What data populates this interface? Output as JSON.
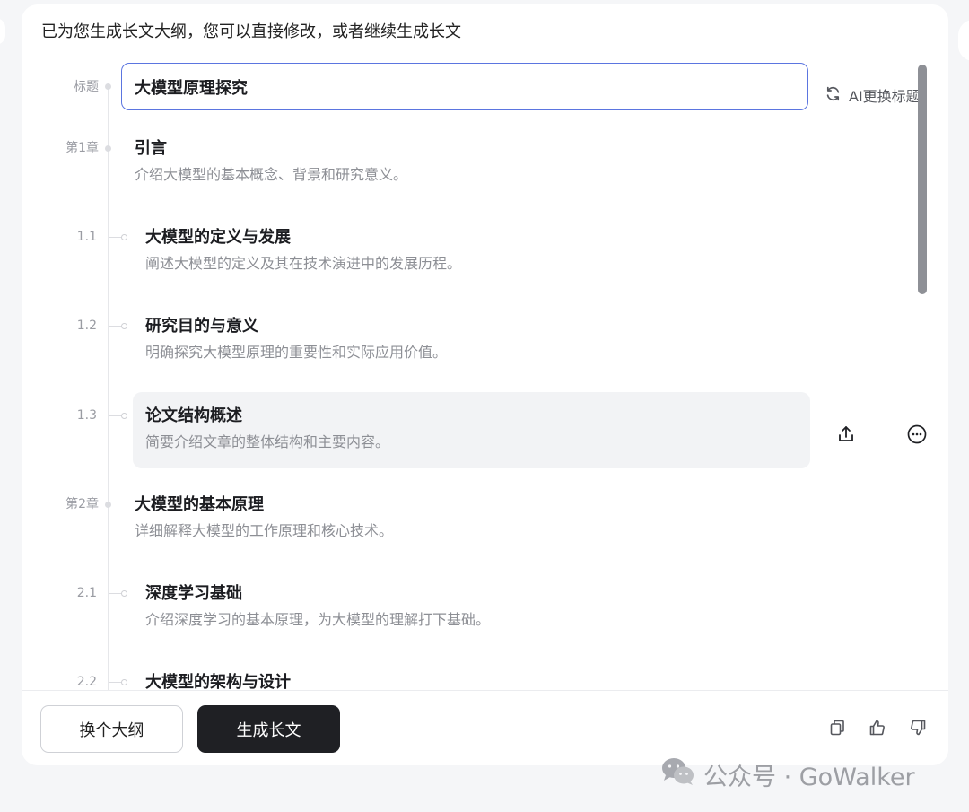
{
  "intro_text": "已为您生成长文大纲，您可以直接修改，或者继续生成长文",
  "title_row": {
    "label": "标题",
    "value": "大模型原理探究",
    "ai_retitle_label": "AI更换标题"
  },
  "chapters": [
    {
      "label": "第1章",
      "title": "引言",
      "desc": "介绍大模型的基本概念、背景和研究意义。",
      "sections": [
        {
          "label": "1.1",
          "title": "大模型的定义与发展",
          "desc": "阐述大模型的定义及其在技术演进中的发展历程。"
        },
        {
          "label": "1.2",
          "title": "研究目的与意义",
          "desc": "明确探究大模型原理的重要性和实际应用价值。"
        },
        {
          "label": "1.3",
          "title": "论文结构概述",
          "desc": "简要介绍文章的整体结构和主要内容。"
        }
      ]
    },
    {
      "label": "第2章",
      "title": "大模型的基本原理",
      "desc": "详细解释大模型的工作原理和核心技术。",
      "sections": [
        {
          "label": "2.1",
          "title": "深度学习基础",
          "desc": "介绍深度学习的基本原理，为大模型的理解打下基础。"
        },
        {
          "label": "2.2",
          "title": "大模型的架构与设计",
          "desc": ""
        }
      ]
    }
  ],
  "row_actions": {
    "upload_icon": "upload-icon",
    "more_icon": "more-circle-icon"
  },
  "footer": {
    "switch_outline_label": "换个大纲",
    "generate_label": "生成长文",
    "icons": [
      "copy-icon",
      "thumbs-up-icon",
      "thumbs-down-icon"
    ]
  },
  "watermark": {
    "text": "公众号 · GoWalker",
    "icon": "wechat-icon"
  },
  "colors": {
    "accent_border": "#5b75e0",
    "primary_button": "#1f2024",
    "background": "#f5f6f8"
  }
}
